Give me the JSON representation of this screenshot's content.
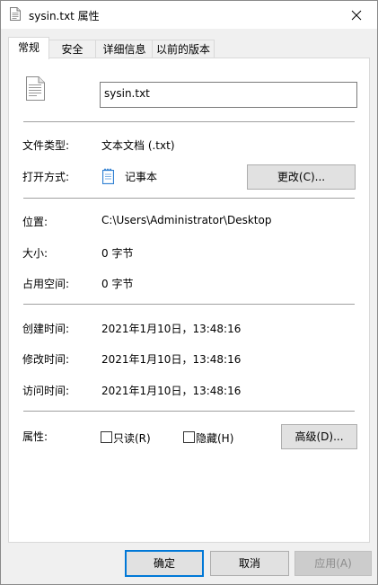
{
  "window": {
    "title": "sysin.txt 属性",
    "close_symbol": "✕"
  },
  "tabs": [
    {
      "label": "常规"
    },
    {
      "label": "安全"
    },
    {
      "label": "详细信息"
    },
    {
      "label": "以前的版本"
    }
  ],
  "general": {
    "file_name": "sysin.txt",
    "file_type_label": "文件类型:",
    "file_type_value": "文本文档 (.txt)",
    "open_with_label": "打开方式:",
    "open_with_app": "记事本",
    "change_button": "更改(C)...",
    "location_label": "位置:",
    "location_value": "C:\\Users\\Administrator\\Desktop",
    "size_label": "大小:",
    "size_value": "0 字节",
    "size_on_disk_label": "占用空间:",
    "size_on_disk_value": "0 字节",
    "created_label": "创建时间:",
    "created_value": "2021年1月10日，13:48:16",
    "modified_label": "修改时间:",
    "modified_value": "2021年1月10日，13:48:16",
    "accessed_label": "访问时间:",
    "accessed_value": "2021年1月10日，13:48:16",
    "attributes_label": "属性:",
    "readonly_label": "只读(R)",
    "readonly_checked": false,
    "hidden_label": "隐藏(H)",
    "hidden_checked": false,
    "advanced_button": "高级(D)..."
  },
  "footer": {
    "ok_button": "确定",
    "cancel_button": "取消",
    "apply_button": "应用(A)"
  },
  "colors": {
    "focus_border": "#0078d7",
    "notepad_icon": "#2f7fd1"
  },
  "icons": {
    "title": "text-file-icon",
    "file": "text-file-icon",
    "app": "notepad-icon",
    "close": "close-icon"
  }
}
